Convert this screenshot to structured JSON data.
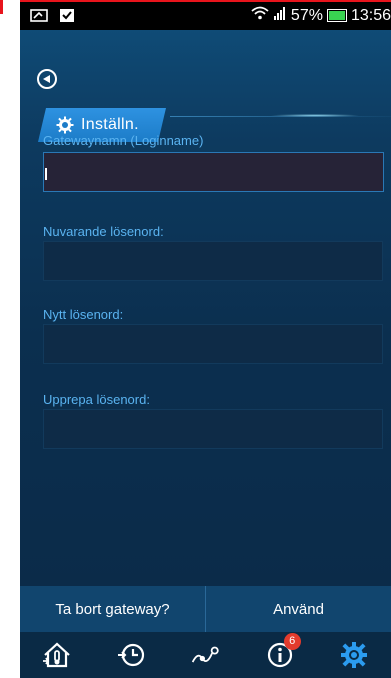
{
  "status_bar": {
    "battery_percent": "57%",
    "time": "13:56",
    "battery_fill": 0.57
  },
  "header": {
    "back_icon": "back-circle-icon",
    "tab_label": "Inställn."
  },
  "form": {
    "gateway_name_label": "Gatewaynamn (Loginname)",
    "gateway_name_value": "",
    "current_password_label": "Nuvarande lösenord:",
    "current_password_value": "",
    "new_password_label": "Nytt lösenord:",
    "new_password_value": "",
    "repeat_password_label": "Upprepa lösenord:",
    "repeat_password_value": ""
  },
  "actions": {
    "remove_gateway": "Ta bort gateway?",
    "apply": "Använd"
  },
  "nav": {
    "items": [
      {
        "icon": "home-thermometer-icon"
      },
      {
        "icon": "history-clock-icon"
      },
      {
        "icon": "graph-nodes-icon"
      },
      {
        "icon": "info-icon",
        "badge": "6"
      },
      {
        "icon": "settings-gear-icon",
        "active": true
      }
    ]
  },
  "colors": {
    "background": "#0d3150",
    "label": "#5ab3f0",
    "tab": "#2e92e1",
    "badge": "#e33b2d",
    "active_icon": "#2b9cf0"
  }
}
